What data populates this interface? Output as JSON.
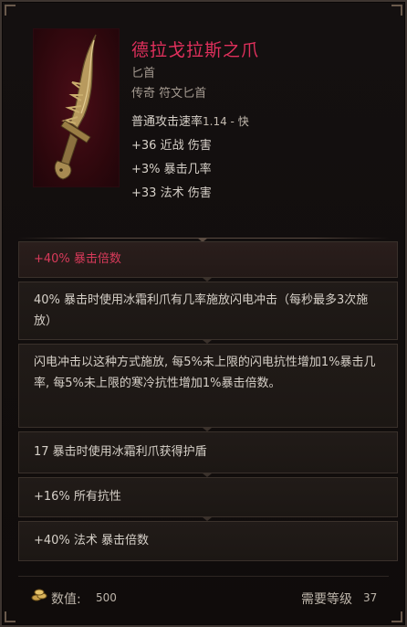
{
  "item": {
    "name": "德拉戈拉斯之爪",
    "type": "匕首",
    "rarity": "传奇 符文匕首"
  },
  "base_stats": {
    "attack_speed_label": "普通攻击速率",
    "attack_speed_value": "1.14 - 快",
    "stats": [
      "+36 近战 伤害",
      "+3% 暴击几率",
      "+33 法术 伤害"
    ]
  },
  "affixes": [
    "+40% 暴击倍数",
    "40% 暴击时使用冰霜利爪有几率施放闪电冲击（每秒最多3次施放）",
    "闪电冲击以这种方式施放, 每5%未上限的闪电抗性增加1%暴击几率, 每5%未上限的寒冷抗性增加1%暴击倍数。",
    "17 暴击时使用冰霜利爪获得护盾",
    "+16% 所有抗性",
    "+40% 法术 暴击倍数"
  ],
  "footer": {
    "value_label": "数值:",
    "value": "500",
    "req_label": "需要等级",
    "req_level": "37"
  },
  "colors": {
    "legendary_name": "#e0305c",
    "highlight_affix": "#d83a5a",
    "text": "#d6d0c8",
    "muted": "#a49a90"
  },
  "icons": {
    "item_art": "dagger-claw-icon",
    "currency": "coin-pile-icon"
  }
}
